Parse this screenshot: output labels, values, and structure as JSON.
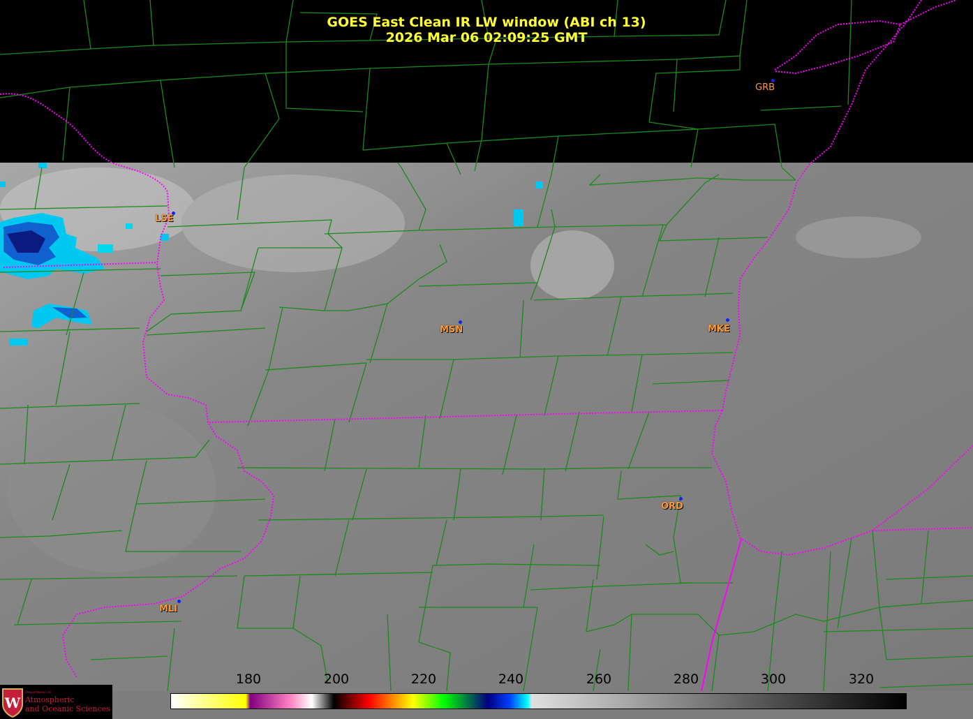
{
  "title": {
    "line1": "GOES East Clean IR LW window (ABI ch 13)",
    "line2": "2026 Mar 06  02:09:25 GMT"
  },
  "stations": [
    {
      "code": "GRB"
    },
    {
      "code": "LSE"
    },
    {
      "code": "MSN"
    },
    {
      "code": "MKE"
    },
    {
      "code": "ORD"
    },
    {
      "code": "MLI"
    }
  ],
  "colorbar": {
    "ticks": [
      "180",
      "200",
      "220",
      "240",
      "260",
      "280",
      "300",
      "320"
    ],
    "range_min": 163,
    "range_max": 330,
    "color_stops": [
      {
        "value": 163,
        "color": "#ffffff"
      },
      {
        "value": 180,
        "color": "#ffff00"
      },
      {
        "value": 181,
        "color": "#800080"
      },
      {
        "value": 190,
        "color": "#ff80c0"
      },
      {
        "value": 195,
        "color": "#ffffff"
      },
      {
        "value": 200,
        "color": "#000000"
      },
      {
        "value": 208,
        "color": "#ff0000"
      },
      {
        "value": 218,
        "color": "#ffff00"
      },
      {
        "value": 225,
        "color": "#00ff00"
      },
      {
        "value": 235,
        "color": "#000080"
      },
      {
        "value": 240,
        "color": "#0040ff"
      },
      {
        "value": 244,
        "color": "#00ffff"
      },
      {
        "value": 245,
        "color": "#e0e0e0"
      },
      {
        "value": 330,
        "color": "#000000"
      }
    ]
  },
  "colors": {
    "title": "#ffff33",
    "county_lines": "#1a8a1a",
    "state_borders": "#ff00ff",
    "station_label": "#ff9933",
    "station_dot": "#1020ff",
    "background": "#000000",
    "ground": "#7d7d7d"
  },
  "logo": {
    "line_small": "Department of",
    "line1": "Atmospheric",
    "line2": "and Oceanic Sciences"
  }
}
